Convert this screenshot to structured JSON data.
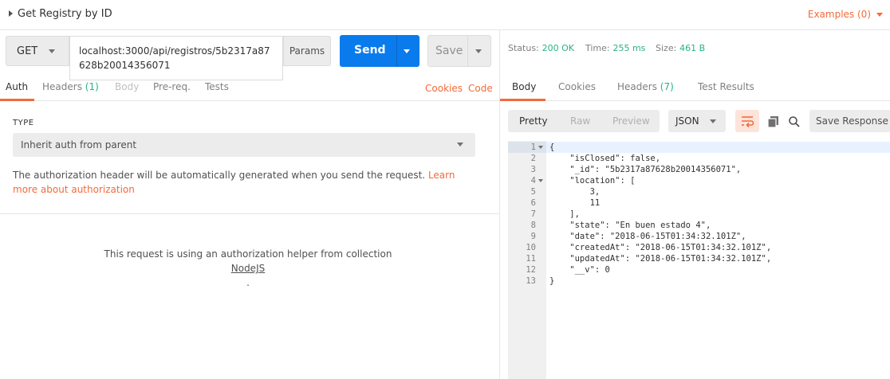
{
  "title_bar": {
    "title": "Get Registry by ID",
    "examples_label": "Examples (0)"
  },
  "request": {
    "method": "GET",
    "url": "localhost:3000/api/registros/5b2317a87628b20014356071",
    "params_label": "Params",
    "send_label": "Send",
    "save_label": "Save"
  },
  "request_tabs": {
    "auth": "Auth",
    "headers": "Headers",
    "headers_count": "(1)",
    "body": "Body",
    "prereq": "Pre-req.",
    "tests": "Tests",
    "cookies": "Cookies",
    "code": "Code"
  },
  "auth": {
    "type_label": "TYPE",
    "selected_type": "Inherit auth from parent",
    "description": "The authorization header will be automatically generated when you send the request.",
    "learn_more": "Learn more about authorization",
    "helper_text": "This request is using an authorization helper from collection",
    "collection_name": "NodeJS",
    "helper_suffix": "."
  },
  "response_status": {
    "status_key": "Status:",
    "status_val": "200 OK",
    "time_key": "Time:",
    "time_val": "255 ms",
    "size_key": "Size:",
    "size_val": "461 B"
  },
  "response_tabs": {
    "body": "Body",
    "cookies": "Cookies",
    "headers": "Headers",
    "headers_count": "(7)",
    "test_results": "Test Results"
  },
  "response_toolbar": {
    "pretty": "Pretty",
    "raw": "Raw",
    "preview": "Preview",
    "language": "JSON",
    "save_response": "Save Response"
  },
  "icons": {
    "wrap": "wrap-lines-icon",
    "copy": "copy-icon",
    "search": "search-icon"
  },
  "colors": {
    "accent": "#f26b3a",
    "send": "#097bed",
    "success": "#26b47f"
  },
  "code": {
    "line_numbers": [
      "1",
      "2",
      "3",
      "4",
      "5",
      "6",
      "7",
      "8",
      "9",
      "10",
      "11",
      "12",
      "13"
    ],
    "lines": [
      "{",
      "    \"isClosed\": false,",
      "    \"_id\": \"5b2317a87628b20014356071\",",
      "    \"location\": [",
      "        3,",
      "        11",
      "    ],",
      "    \"state\": \"En buen estado 4\",",
      "    \"date\": \"2018-06-15T01:34:32.101Z\",",
      "    \"createdAt\": \"2018-06-15T01:34:32.101Z\",",
      "    \"updatedAt\": \"2018-06-15T01:34:32.101Z\",",
      "    \"__v\": 0",
      "}"
    ]
  }
}
